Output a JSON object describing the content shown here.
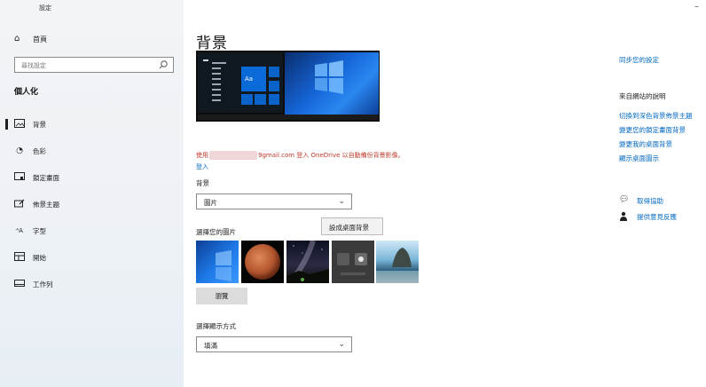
{
  "window": {
    "title": "設定",
    "minimize_glyph": "–"
  },
  "sidebar": {
    "back_glyph": "←",
    "home_label": "首頁",
    "search_placeholder": "尋找設定",
    "section_title": "個人化",
    "items": [
      {
        "label": "背景",
        "icon": "picture-icon",
        "active": true
      },
      {
        "label": "色彩",
        "icon": "palette-icon",
        "active": false
      },
      {
        "label": "鎖定畫面",
        "icon": "lock-screen-icon",
        "active": false
      },
      {
        "label": "佈景主題",
        "icon": "themes-icon",
        "active": false
      },
      {
        "label": "字型",
        "icon": "font-icon",
        "active": false
      },
      {
        "label": "開始",
        "icon": "start-icon",
        "active": false
      },
      {
        "label": "工作列",
        "icon": "taskbar-icon",
        "active": false
      }
    ]
  },
  "main": {
    "title": "背景",
    "preview": {
      "tile_label": "Aa"
    },
    "onedrive_prefix": "使用",
    "onedrive_suffix": "9gmail.com 登入 OneDrive 以自動備份背景影像。",
    "signin_link": "登入",
    "background_label": "背景",
    "background_value": "圖片",
    "set_background_tooltip": "設成桌面背景",
    "choose_picture_label": "選擇您的圖片",
    "thumbnails": [
      "windows-default",
      "mars",
      "milky-way",
      "settings-dark",
      "beach-rock"
    ],
    "browse_button": "瀏覽",
    "fit_label": "選擇顯示方式",
    "fit_value": "填滿"
  },
  "right": {
    "sync_link": "同步您的設定",
    "web_help_heading": "來自網站的說明",
    "web_links": [
      "切換到深色背景佈景主題",
      "變更您的鎖定畫面背景",
      "變更我的桌面背景",
      "顯示桌面圖示"
    ],
    "get_help": "取得協助",
    "feedback": "提供意見反應"
  },
  "colors": {
    "accent": "#0067c0",
    "warning": "#c0392b",
    "sidebar_bg": "#f2f4f7"
  }
}
